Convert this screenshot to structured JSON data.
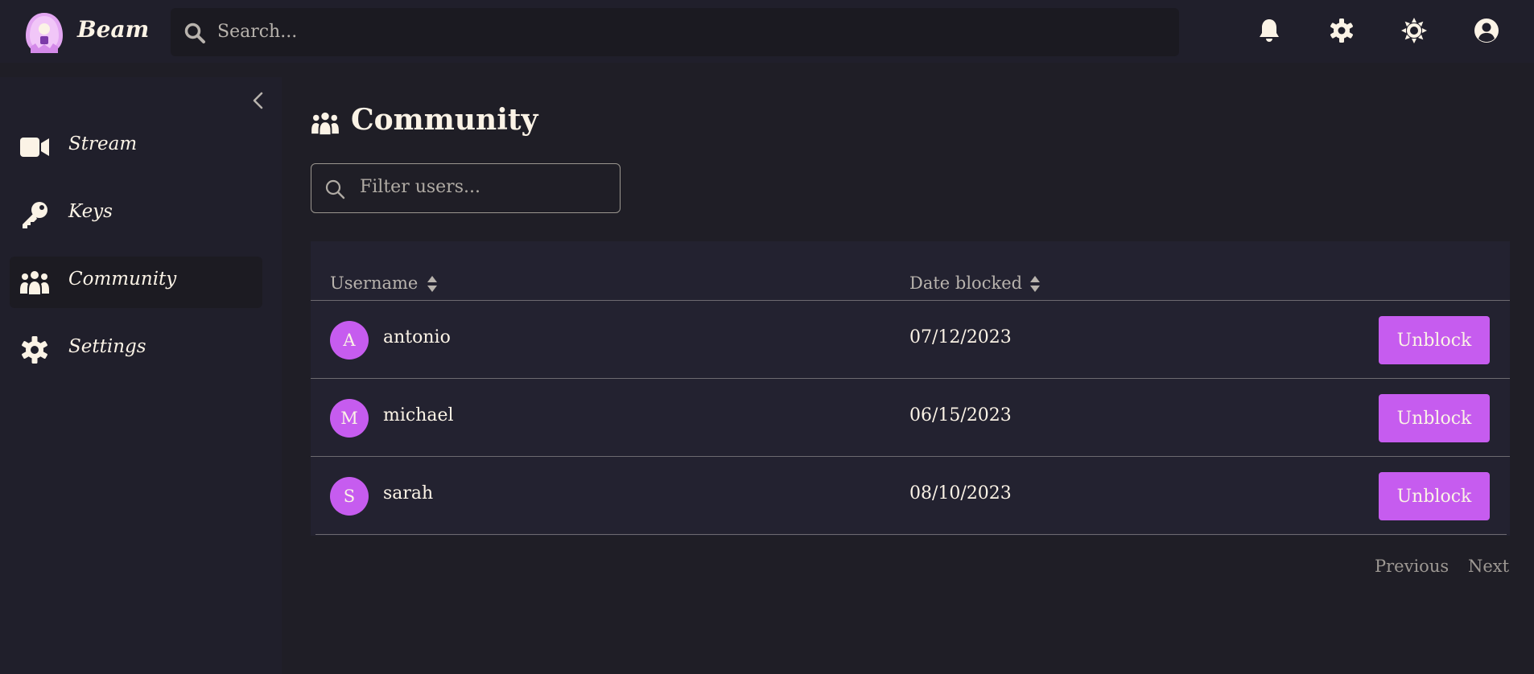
{
  "app": {
    "name": "Beam"
  },
  "search": {
    "placeholder": "Search..."
  },
  "topbar_icons": [
    "bell-icon",
    "gear-icon",
    "sun-icon",
    "user-circle-icon"
  ],
  "sidebar": {
    "items": [
      {
        "label": "Stream",
        "icon": "video-camera-icon",
        "active": false
      },
      {
        "label": "Keys",
        "icon": "key-icon",
        "active": false
      },
      {
        "label": "Community",
        "icon": "users-icon",
        "active": true
      },
      {
        "label": "Settings",
        "icon": "gear-icon",
        "active": false
      }
    ]
  },
  "page": {
    "title": "Community",
    "filter_placeholder": "Filter users..."
  },
  "table": {
    "columns": [
      "Username",
      "Date blocked"
    ],
    "rows": [
      {
        "initial": "A",
        "username": "antonio",
        "date": "07/12/2023",
        "action": "Unblock"
      },
      {
        "initial": "M",
        "username": "michael",
        "date": "06/15/2023",
        "action": "Unblock"
      },
      {
        "initial": "S",
        "username": "sarah",
        "date": "08/10/2023",
        "action": "Unblock"
      }
    ]
  },
  "pagination": {
    "previous": "Previous",
    "next": "Next"
  },
  "colors": {
    "accent": "#c65cef",
    "background": "#1f1e26",
    "panel": "#201f2b",
    "text": "#fbf3e6"
  }
}
